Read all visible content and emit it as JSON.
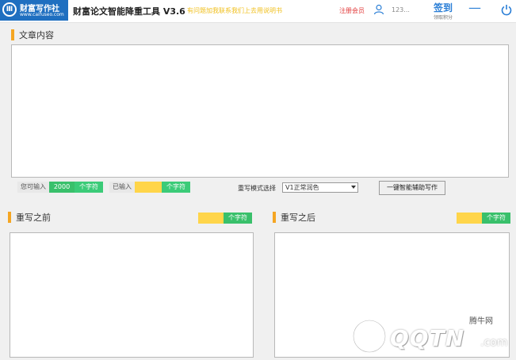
{
  "titlebar": {
    "logo_name": "财富写作社",
    "logo_url": "www.caifuseo.com",
    "app_title": "财富论文智能降重工具 V3.6",
    "notice": "有问题加我联系我们上去用说明书",
    "register_label": "注册会员",
    "user_id": "123...",
    "signin_label": "签到",
    "signin_sub": "领取积分"
  },
  "article": {
    "section_title": "文章内容",
    "allowed_label": "您可输入",
    "allowed_value": "2000",
    "allowed_unit": "个字符",
    "entered_label": "已输入",
    "entered_value": "",
    "entered_unit": "个字符"
  },
  "controls": {
    "mode_label": "重写模式选择",
    "mode_selected": "V1正常润色",
    "assist_button": "一键智能辅助写作"
  },
  "before": {
    "section_title": "重写之前",
    "count_value": "",
    "count_unit": "个字符"
  },
  "after": {
    "section_title": "重写之后",
    "count_value": "",
    "count_unit": "个字符"
  },
  "watermark": {
    "cn": "腾牛网",
    "text": "QQTN",
    "domain": ".com"
  },
  "colors": {
    "accent_orange": "#f5a623",
    "green": "#39c06b",
    "yellow": "#ffd54a",
    "blue": "#2a7ed6",
    "red": "#e23b3b"
  },
  "icons": {
    "logo": "bookshelf-emblem-icon",
    "user": "user-icon",
    "minimize": "minimize-icon",
    "power": "power-icon"
  }
}
